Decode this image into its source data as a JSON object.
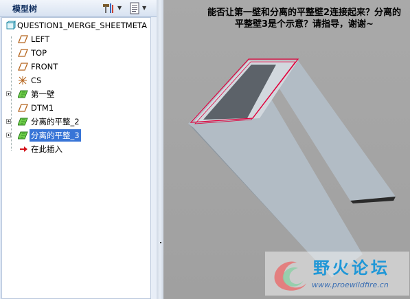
{
  "model_tree": {
    "title": "模型树",
    "root": "QUESTION1_MERGE_SHEETMETA",
    "items": [
      {
        "label": "LEFT",
        "icon": "datum-plane-icon",
        "expandable": false
      },
      {
        "label": "TOP",
        "icon": "datum-plane-icon",
        "expandable": false
      },
      {
        "label": "FRONT",
        "icon": "datum-plane-icon",
        "expandable": false
      },
      {
        "label": "CS",
        "icon": "coordinate-system-icon",
        "expandable": false
      },
      {
        "label": "第一壁",
        "icon": "sheetmetal-wall-icon",
        "expandable": true
      },
      {
        "label": "DTM1",
        "icon": "datum-plane-icon",
        "expandable": false
      },
      {
        "label": "分离的平整_2",
        "icon": "sheetmetal-wall-icon",
        "expandable": true
      },
      {
        "label": "分离的平整_3",
        "icon": "sheetmetal-wall-icon",
        "expandable": true,
        "selected": true
      },
      {
        "label": "在此插入",
        "icon": "insert-arrow-icon",
        "expandable": false
      }
    ]
  },
  "question_text": "能否让第一壁和分离的平整壁2连接起来？分离的平整壁3是个示意？请指导，谢谢~",
  "watermark": {
    "title": "野火论坛",
    "url": "www.proewildfire.cn"
  },
  "colors": {
    "tree_bg": "#ffffff",
    "panel_bg": "#dfe8f6",
    "selected": "#3875d7",
    "graphics_bg": "#a3a3a3",
    "part_face": "#b4bec7",
    "part_dark": "#5d646c",
    "highlight": "#e0003c"
  }
}
